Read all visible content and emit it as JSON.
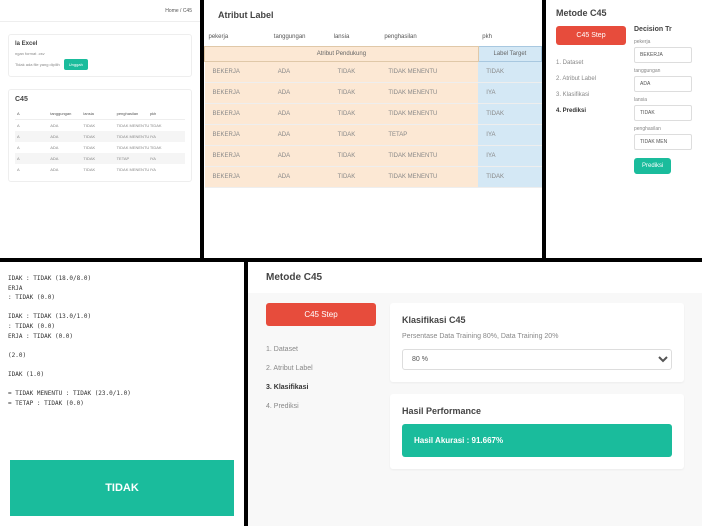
{
  "p1": {
    "nav": {
      "home": "Home",
      "c45": "C45"
    },
    "upload": {
      "title": "la Excel",
      "sub1": "ngan format .csv",
      "sub2": "Tidak ada file yang dipilih",
      "btn": "Unggah"
    },
    "tbl": {
      "title": "C45",
      "headers": [
        "tanggungan",
        "lansia",
        "penghasilan",
        "pkh"
      ],
      "rows": [
        [
          "ADA",
          "TIDAK",
          "TIDAK MENENTU",
          "TIDAK"
        ],
        [
          "ADA",
          "TIDAK",
          "TIDAK MENENTU",
          "IYA"
        ],
        [
          "ADA",
          "TIDAK",
          "TIDAK MENENTU",
          "TIDAK"
        ],
        [
          "ADA",
          "TIDAK",
          "TETAP",
          "IYA"
        ],
        [
          "ADA",
          "TIDAK",
          "TIDAK MENENTU",
          "IYA"
        ]
      ]
    }
  },
  "p2": {
    "title": "Atribut Label",
    "headers": [
      "pekerja",
      "tanggungan",
      "lansia",
      "penghasilan",
      "pkh"
    ],
    "group_sup": "Atribut Pendukung",
    "group_tgt": "Label Target",
    "rows": [
      [
        "BEKERJA",
        "ADA",
        "TIDAK",
        "TIDAK MENENTU",
        "TIDAK"
      ],
      [
        "BEKERJA",
        "ADA",
        "TIDAK",
        "TIDAK MENENTU",
        "IYA"
      ],
      [
        "BEKERJA",
        "ADA",
        "TIDAK",
        "TIDAK MENENTU",
        "TIDAK"
      ],
      [
        "BEKERJA",
        "ADA",
        "TIDAK",
        "TETAP",
        "IYA"
      ],
      [
        "BEKERJA",
        "ADA",
        "TIDAK",
        "TIDAK MENENTU",
        "IYA"
      ],
      [
        "BEKERJA",
        "ADA",
        "TIDAK",
        "TIDAK MENENTU",
        "TIDAK"
      ]
    ]
  },
  "p3": {
    "title": "Metode C45",
    "step_btn": "C45 Step",
    "steps": [
      "1. Dataset",
      "2. Atribut Label",
      "3. Klasifikasi",
      "4. Prediksi"
    ],
    "active_step": 3,
    "form_title": "Decision Tr",
    "fields": [
      {
        "label": "pekerja",
        "value": "BEKERJA"
      },
      {
        "label": "tanggungan",
        "value": "ADA"
      },
      {
        "label": "lansia",
        "value": "TIDAK"
      },
      {
        "label": "penghasilan",
        "value": "TIDAK MEN"
      }
    ],
    "predict_btn": "Prediksi"
  },
  "p4": {
    "code": "IDAK : TIDAK (18.0/8.0)\nERJA\n: TIDAK (0.0)\n\nIDAK : TIDAK (13.0/1.0)\n: TIDAK (0.0)\nERJA : TIDAK (0.0)\n\n(2.0)\n\nIDAK (1.0)\n\n= TIDAK MENENTU : TIDAK (23.0/1.0)\n= TETAP : TIDAK (0.0)",
    "result": "TIDAK"
  },
  "p5": {
    "title": "Metode C45",
    "step_btn": "C45 Step",
    "steps": [
      "1. Dataset",
      "2. Atribut Label",
      "3. Klasifikasi",
      "4. Prediksi"
    ],
    "active_step": 2,
    "card1": {
      "title": "Klasifikasi C45",
      "sub": "Persentase Data Training 80%, Data Training 20%",
      "select": "80 %"
    },
    "card2": {
      "title": "Hasil Performance",
      "result": "Hasil Akurasi : 91.667%"
    }
  }
}
